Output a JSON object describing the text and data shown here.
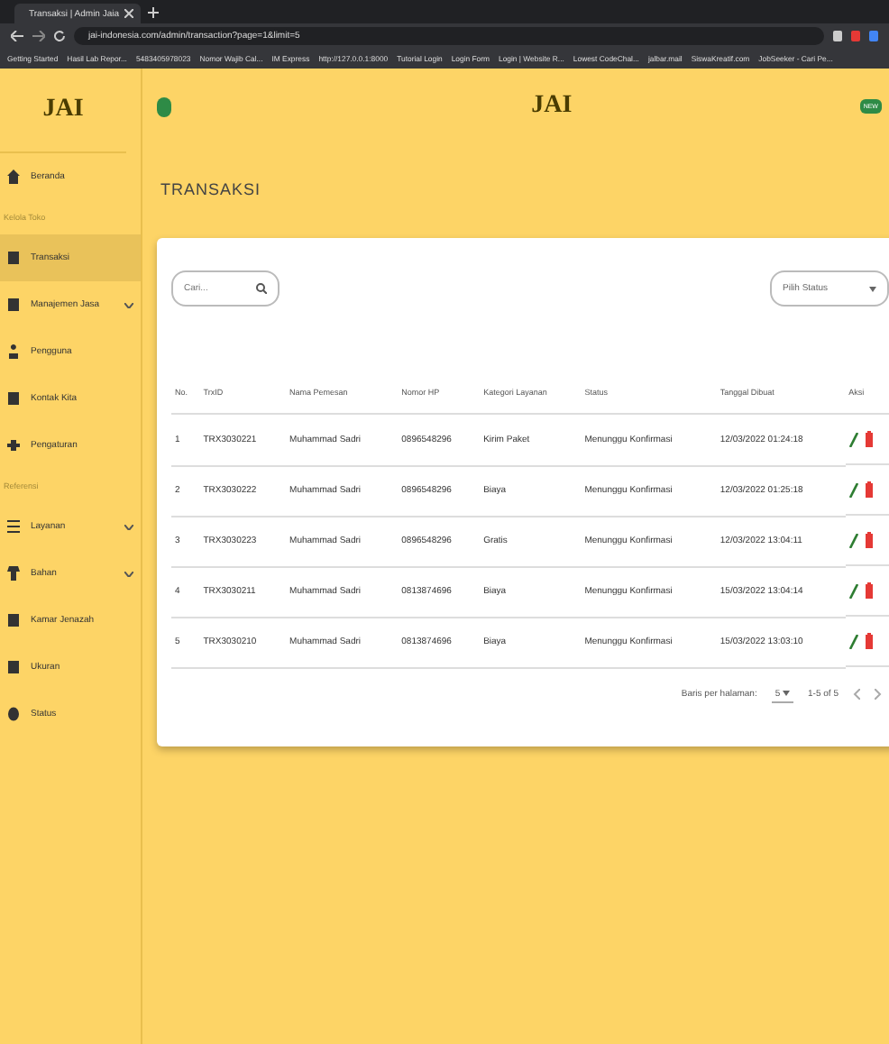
{
  "browser": {
    "tab_title": "Transaksi | Admin Jaia",
    "url": "jai-indonesia.com/admin/transaction?page=1&limit=5",
    "bookmarks": [
      "Getting Started",
      "Hasil Lab Repor...",
      "5483405978023",
      "Nomor Wajib Cal...",
      "IM Express",
      "http://127.0.0.1:8000",
      "Tutorial Login",
      "Login Form",
      "Login | Website R...",
      "Lowest CodeChal...",
      "jalbar.mail",
      "SiswaKreatif.com",
      "JobSeeker - Cari Pe..."
    ]
  },
  "header": {
    "sidebar_logo": "JAI",
    "center_logo": "JAI",
    "badge": "NEW"
  },
  "sidebar": {
    "items": [
      {
        "kind": "link",
        "label": "Beranda",
        "selected": false
      },
      {
        "kind": "section",
        "label": "Kelola Toko"
      },
      {
        "kind": "link",
        "label": "Transaksi",
        "selected": true
      },
      {
        "kind": "group",
        "label": "Manajemen Jasa",
        "selected": false
      },
      {
        "kind": "link",
        "label": "Pengguna",
        "selected": false
      },
      {
        "kind": "link",
        "label": "Kontak Kita",
        "selected": false
      },
      {
        "kind": "link",
        "label": "Pengaturan",
        "selected": false
      },
      {
        "kind": "section",
        "label": "Referensi"
      },
      {
        "kind": "group",
        "label": "Layanan",
        "selected": false
      },
      {
        "kind": "group",
        "label": "Bahan",
        "selected": false
      },
      {
        "kind": "link",
        "label": "Kamar Jenazah",
        "selected": false
      },
      {
        "kind": "link",
        "label": "Ukuran",
        "selected": false
      },
      {
        "kind": "link",
        "label": "Status",
        "selected": false
      }
    ]
  },
  "page_title": "TRANSAKSI",
  "search": {
    "placeholder": "Cari..."
  },
  "status_filter": {
    "placeholder": "Pilih Status"
  },
  "table": {
    "columns": [
      "No.",
      "TrxID",
      "Nama Pemesan",
      "Nomor HP",
      "Kategori Layanan",
      "Status",
      "Tanggal Dibuat",
      "Aksi"
    ],
    "rows": [
      [
        "1",
        "TRX3030221",
        "Muhammad Sadri",
        "0896548296",
        "Kirim Paket",
        "Menunggu Konfirmasi",
        "12/03/2022 01:24:18"
      ],
      [
        "2",
        "TRX3030222",
        "Muhammad Sadri",
        "0896548296",
        "Biaya",
        "Menunggu Konfirmasi",
        "12/03/2022 01:25:18"
      ],
      [
        "3",
        "TRX3030223",
        "Muhammad Sadri",
        "0896548296",
        "Gratis",
        "Menunggu Konfirmasi",
        "12/03/2022 13:04:11"
      ],
      [
        "4",
        "TRX3030211",
        "Muhammad Sadri",
        "0813874696",
        "Biaya",
        "Menunggu Konfirmasi",
        "15/03/2022 13:04:14"
      ],
      [
        "5",
        "TRX3030210",
        "Muhammad Sadri",
        "0813874696",
        "Biaya",
        "Menunggu Konfirmasi",
        "15/03/2022 13:03:10"
      ]
    ]
  },
  "pagination": {
    "rows_label": "Baris per halaman:",
    "rows_value": "5",
    "range": "1-5 of 5"
  }
}
